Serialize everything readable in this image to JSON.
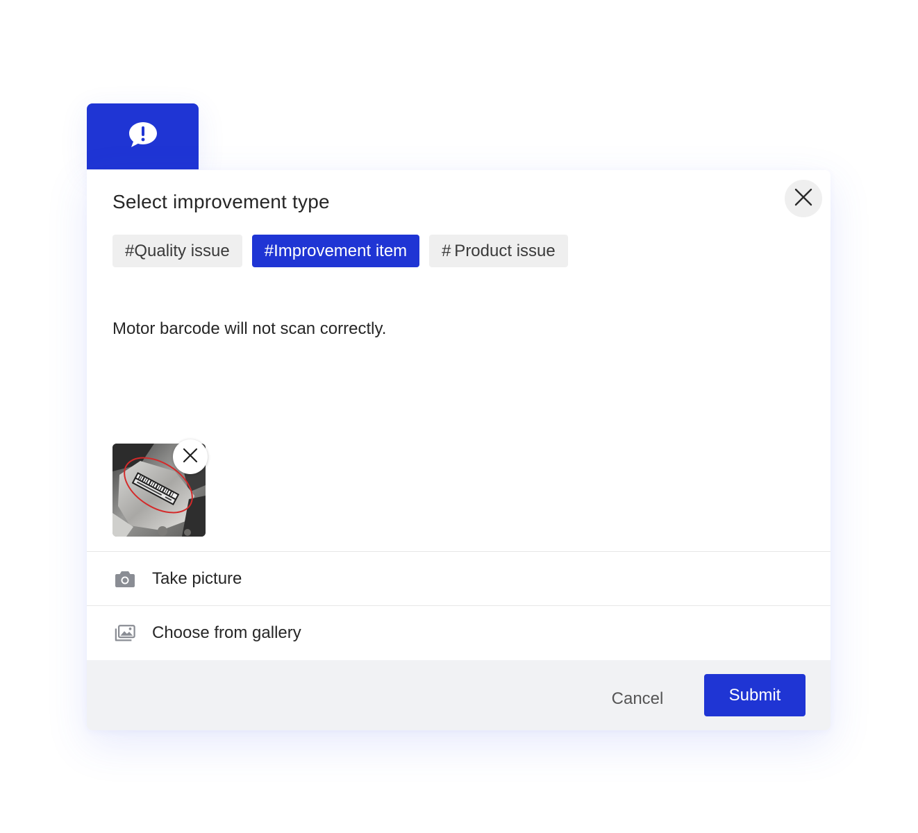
{
  "header": {
    "badge_icon": "speech-bubble-exclamation-icon",
    "accent_color": "#1f35d4"
  },
  "dialog": {
    "title": "Select improvement type",
    "close_icon": "close-icon",
    "tags": [
      {
        "label": "#Quality issue",
        "selected": false
      },
      {
        "label": "#Improvement item",
        "selected": true
      },
      {
        "label": "# Product issue",
        "selected": false
      }
    ],
    "description": "Motor barcode will not scan correctly.",
    "attachment": {
      "remove_icon": "close-icon"
    },
    "actions": [
      {
        "icon": "camera-icon",
        "label": "Take picture"
      },
      {
        "icon": "gallery-icon",
        "label": "Choose from gallery"
      }
    ],
    "footer": {
      "cancel_label": "Cancel",
      "submit_label": "Submit"
    }
  }
}
